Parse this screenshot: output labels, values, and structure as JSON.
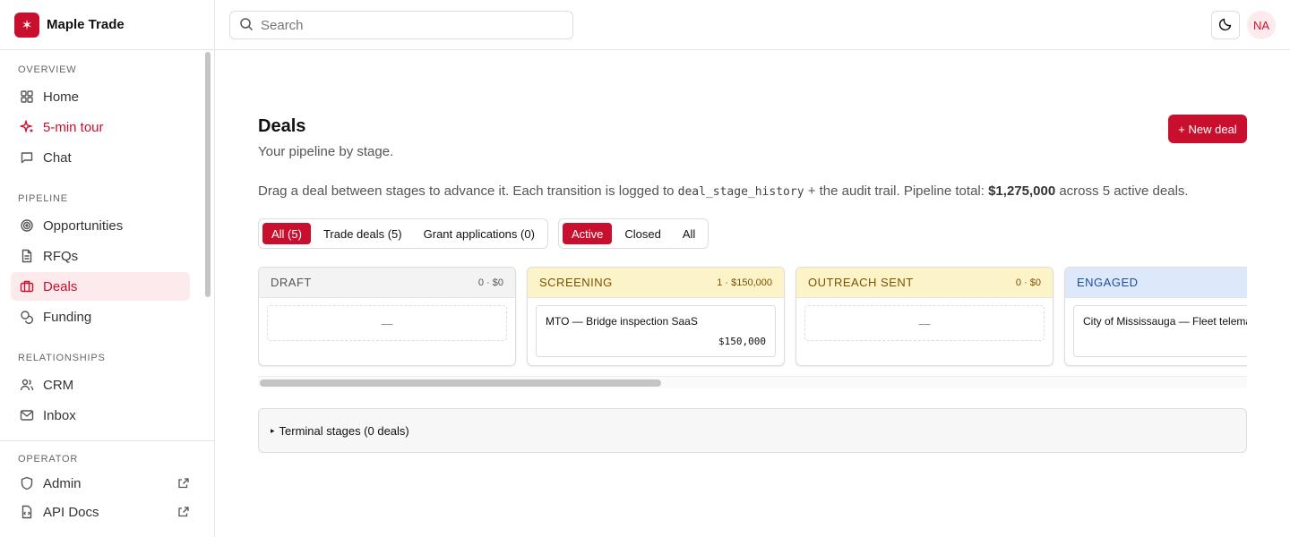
{
  "brand": {
    "name": "Maple Trade",
    "logo_glyph": "✶"
  },
  "sidebar": {
    "sections": [
      {
        "title": "OVERVIEW",
        "items": [
          {
            "label": "Home",
            "icon": "grid-icon"
          },
          {
            "label": "5-min tour",
            "icon": "sparkle-icon"
          },
          {
            "label": "Chat",
            "icon": "chat-icon"
          }
        ]
      },
      {
        "title": "PIPELINE",
        "items": [
          {
            "label": "Opportunities",
            "icon": "target-icon"
          },
          {
            "label": "RFQs",
            "icon": "document-icon"
          },
          {
            "label": "Deals",
            "icon": "briefcase-icon",
            "active": true
          },
          {
            "label": "Funding",
            "icon": "coins-icon"
          }
        ]
      },
      {
        "title": "RELATIONSHIPS",
        "items": [
          {
            "label": "CRM",
            "icon": "users-icon"
          },
          {
            "label": "Inbox",
            "icon": "mail-icon"
          }
        ]
      }
    ],
    "operator": {
      "title": "OPERATOR",
      "items": [
        {
          "label": "Admin",
          "icon": "shield-icon",
          "external": true
        },
        {
          "label": "API Docs",
          "icon": "code-file-icon",
          "external": true
        }
      ]
    }
  },
  "topbar": {
    "search_placeholder": "Search",
    "avatar_initials": "NA"
  },
  "page": {
    "title": "Deals",
    "subtitle": "Your pipeline by stage.",
    "new_button": "+ New deal",
    "desc_prefix": "Drag a deal between stages to advance it. Each transition is logged to",
    "desc_code": "deal_stage_history",
    "desc_mid": "+ the audit trail. Pipeline total:",
    "desc_total": "$1,275,000",
    "desc_suffix": "across 5 active deals."
  },
  "filters": {
    "type": [
      "All (5)",
      "Trade deals (5)",
      "Grant applications (0)"
    ],
    "type_selected": "All (5)",
    "status": [
      "Active",
      "Closed",
      "All"
    ],
    "status_selected": "Active"
  },
  "stages": [
    {
      "name": "DRAFT",
      "meta": "0 · $0",
      "header_bg": "#f3f3f3",
      "text_color": "#555555",
      "cards": [],
      "empty_text": "—"
    },
    {
      "name": "SCREENING",
      "meta": "1 · $150,000",
      "header_bg": "#fdf3c8",
      "text_color": "#7a5200",
      "cards": [
        {
          "title": "MTO — Bridge inspection SaaS",
          "amount": "$150,000"
        }
      ]
    },
    {
      "name": "OUTREACH SENT",
      "meta": "0 · $0",
      "header_bg": "#fdf3c8",
      "text_color": "#7a5200",
      "cards": [],
      "empty_text": "—"
    },
    {
      "name": "ENGAGED",
      "meta": "",
      "header_bg": "#dde9fb",
      "text_color": "#1d4ea0",
      "cards": [
        {
          "title": "City of Mississauga — Fleet telema",
          "amount": ""
        }
      ]
    }
  ],
  "terminal": {
    "label": "Terminal stages (0 deals)"
  },
  "colors": {
    "accent": "#c8102e",
    "accent_soft": "#fdeaec"
  }
}
